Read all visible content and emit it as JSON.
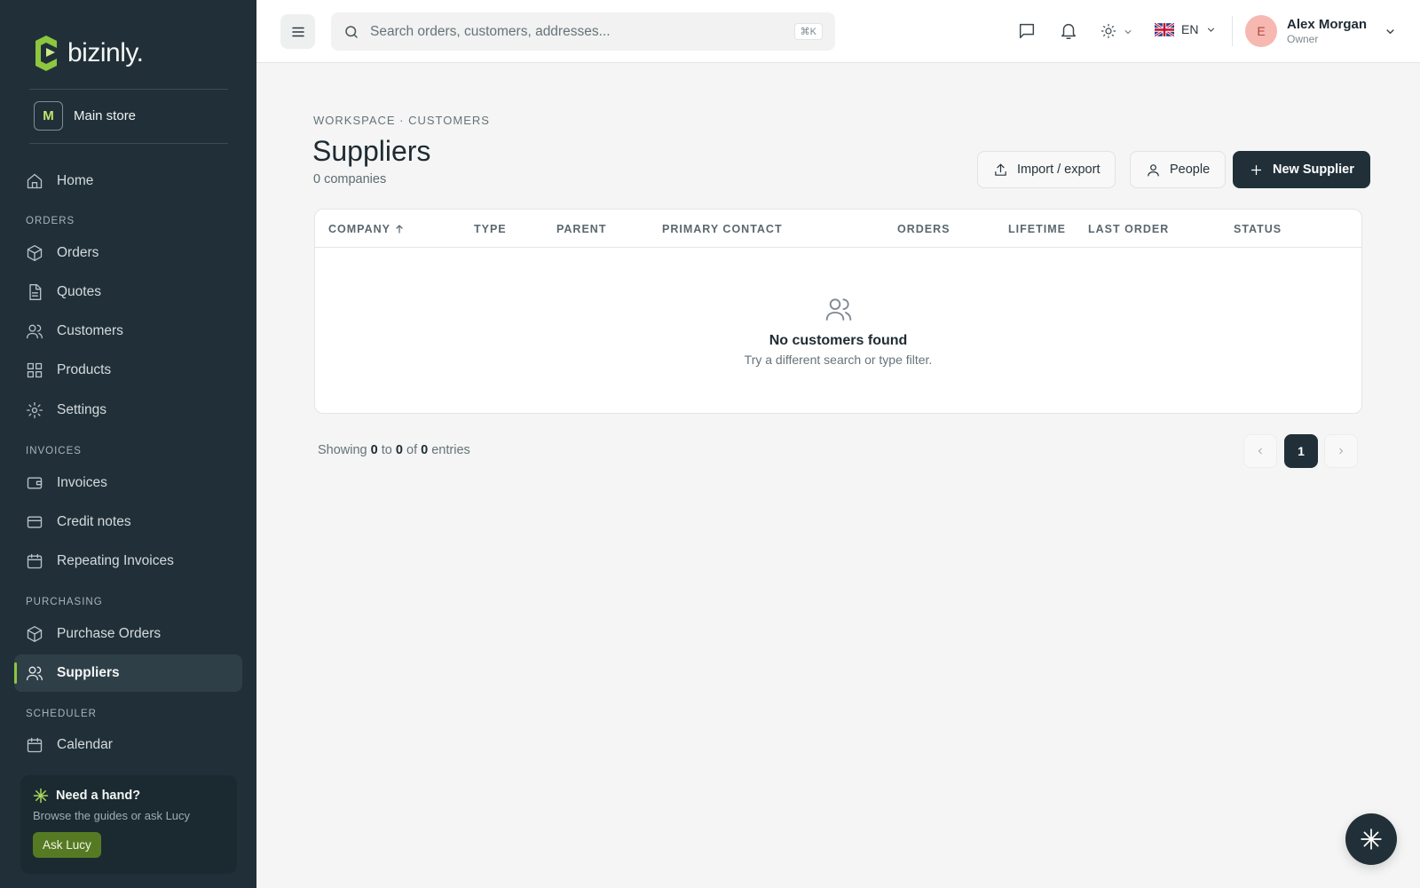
{
  "app": {
    "brand": "bizinly.",
    "accent": "#8dc63f"
  },
  "sidebar": {
    "store": {
      "initial": "M",
      "name": "Main store"
    },
    "sections": {
      "orders": "ORDERS",
      "invoices": "INVOICES",
      "purchasing": "PURCHASING",
      "scheduler": "SCHEDULER"
    },
    "items": {
      "home": "Home",
      "orders": "Orders",
      "quotes": "Quotes",
      "customers": "Customers",
      "products": "Products",
      "settings": "Settings",
      "invoices": "Invoices",
      "credit_notes": "Credit notes",
      "repeating_invoices": "Repeating Invoices",
      "purchase_orders": "Purchase Orders",
      "suppliers": "Suppliers",
      "calendar": "Calendar"
    },
    "active": "suppliers",
    "help": {
      "title": "Need a hand?",
      "subtitle": "Browse the guides or ask Lucy",
      "button": "Ask Lucy"
    }
  },
  "topbar": {
    "search_placeholder": "Search orders, customers, addresses...",
    "shortcut": "⌘K",
    "language": "EN",
    "user": {
      "initial": "E",
      "name": "Alex Morgan",
      "role": "Owner"
    }
  },
  "page": {
    "breadcrumb": "WORKSPACE · CUSTOMERS",
    "title": "Suppliers",
    "subtitle": "0 companies",
    "actions": {
      "import_export": "Import / export",
      "people": "People",
      "new_supplier": "New Supplier"
    }
  },
  "table": {
    "columns": [
      "COMPANY",
      "TYPE",
      "PARENT",
      "PRIMARY CONTACT",
      "ORDERS",
      "LIFETIME",
      "LAST ORDER",
      "STATUS"
    ],
    "sort": {
      "column": "COMPANY",
      "direction": "ascending"
    },
    "rows": [],
    "empty": {
      "title": "No customers found",
      "subtitle": "Try a different search or type filter."
    }
  },
  "pagination": {
    "showing_prefix": "Showing",
    "from": "0",
    "to_word": "to",
    "to": "0",
    "of_word": "of",
    "total": "0",
    "suffix": "entries",
    "pages": [
      "1"
    ],
    "current_page": "1"
  }
}
